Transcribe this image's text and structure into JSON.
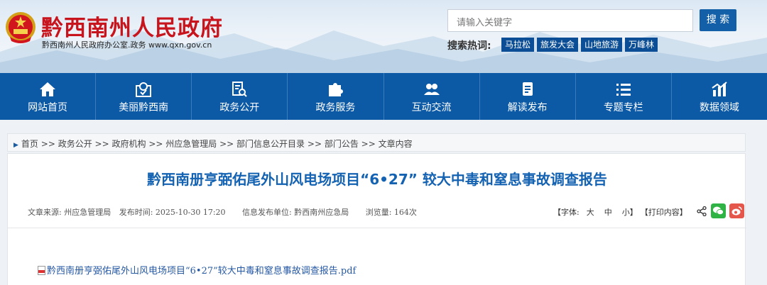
{
  "site": {
    "title": "黔西南州人民政府",
    "subtitle": "黔西南州人民政府办公室.政务  www.qxn.gov.cn"
  },
  "search": {
    "placeholder": "请输入关键字",
    "button": "搜 索",
    "hot_label": "搜索热词:",
    "hot_words": [
      "马拉松",
      "旅发大会",
      "山地旅游",
      "万峰林"
    ]
  },
  "nav": [
    {
      "label": "网站首页",
      "icon": "home-icon"
    },
    {
      "label": "美丽黔西南",
      "icon": "map-pin-icon"
    },
    {
      "label": "政务公开",
      "icon": "document-search-icon"
    },
    {
      "label": "政务服务",
      "icon": "puzzle-icon"
    },
    {
      "label": "互动交流",
      "icon": "people-icon"
    },
    {
      "label": "解读发布",
      "icon": "file-icon"
    },
    {
      "label": "专题专栏",
      "icon": "list-icon"
    },
    {
      "label": "数据领域",
      "icon": "chart-icon"
    }
  ],
  "breadcrumb": [
    "首页",
    "政务公开",
    "政府机构",
    "州应急管理局",
    "部门信息公开目录",
    "部门公告",
    "文章内容"
  ],
  "article": {
    "title": "黔西南册亨弼佑尾外山风电场项目“6•27” 较大中毒和窒息事故调查报告",
    "source": "文章来源: 州应急管理局",
    "date": "发布时间: 2025-10-30 17:20",
    "publisher": "信息发布单位: 黔西南州应急局",
    "views": "浏览量: 164次",
    "font_label": "【字体:",
    "font_large": "大",
    "font_medium": "中",
    "font_small": "小】",
    "print": "【打印内容】",
    "attachment": "黔西南册亨弼佑尾外山风电场项目“6•27”较大中毒和窒息事故调查报告.pdf"
  },
  "colors": {
    "brand_red": "#c8151d",
    "nav_blue": "#0c59a6",
    "title_blue": "#1462b2",
    "wechat_green": "#2fb344",
    "weibo_red": "#e5574b"
  }
}
